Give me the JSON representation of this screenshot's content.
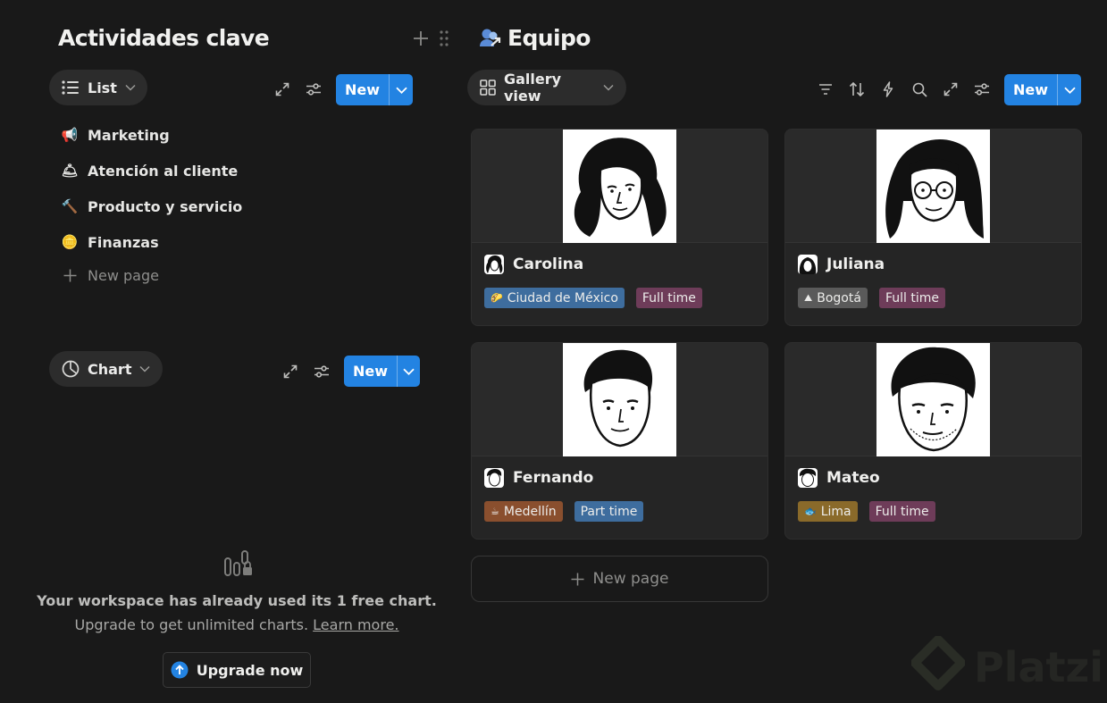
{
  "left": {
    "title": "Actividades clave",
    "list_view": {
      "label": "List",
      "new_label": "New",
      "items": [
        {
          "emoji": "📢",
          "label": "Marketing"
        },
        {
          "emoji": "🛎",
          "label": "Atención al cliente"
        },
        {
          "emoji": "🔨",
          "label": "Producto y servicio"
        },
        {
          "emoji": "🪙",
          "label": "Finanzas"
        }
      ],
      "new_page": "New page"
    },
    "chart_view": {
      "label": "Chart",
      "new_label": "New",
      "message_line1": "Your workspace has already used its 1 free chart.",
      "message_line2": "Upgrade to get unlimited charts.",
      "learn_more": "Learn more.",
      "upgrade_label": "Upgrade now"
    }
  },
  "right": {
    "title": "Equipo",
    "view_label": "Gallery view",
    "new_label": "New",
    "cards": [
      {
        "name": "Carolina",
        "tags": [
          {
            "icon": "🌮",
            "label": "Ciudad de México",
            "color": "#3e6d9e"
          },
          {
            "label": "Full time",
            "color": "#6e3c59"
          }
        ]
      },
      {
        "name": "Juliana",
        "tags": [
          {
            "icon": "⛰",
            "label": "Bogotá",
            "color": "#5a5a5a"
          },
          {
            "label": "Full time",
            "color": "#6e3c59"
          }
        ]
      },
      {
        "name": "Fernando",
        "tags": [
          {
            "icon": "☕",
            "label": "Medellín",
            "color": "#8a4f2e"
          },
          {
            "label": "Part time",
            "color": "#3e6d9e"
          }
        ]
      },
      {
        "name": "Mateo",
        "tags": [
          {
            "icon": "🐟",
            "label": "Lima",
            "color": "#8a6a2a"
          },
          {
            "label": "Full time",
            "color": "#6e3c59"
          }
        ]
      }
    ],
    "new_page": "New page"
  },
  "watermark": "Platzi",
  "colors": {
    "background": "#191919",
    "accent": "#2383e2"
  }
}
